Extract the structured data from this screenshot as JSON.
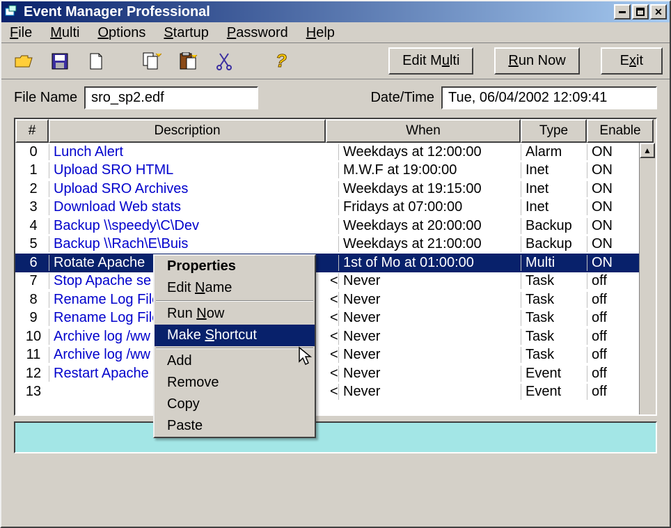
{
  "window": {
    "title": "Event Manager Professional"
  },
  "menubar": [
    "File",
    "Multi",
    "Options",
    "Startup",
    "Password",
    "Help"
  ],
  "toolbar_buttons": {
    "edit_multi": "Edit Multi",
    "run_now": "Run Now",
    "exit": "Exit"
  },
  "form": {
    "file_name_label": "File Name",
    "file_name_value": "sro_sp2.edf",
    "datetime_label": "Date/Time",
    "datetime_value": "Tue, 06/04/2002  12:09:41"
  },
  "columns": {
    "num": "#",
    "desc": "Description",
    "when": "When",
    "type": "Type",
    "enable": "Enable"
  },
  "rows": [
    {
      "n": "0",
      "desc": "Lunch Alert",
      "arrow": "",
      "when": "Weekdays at 12:00:00",
      "type": "Alarm",
      "enable": "ON",
      "sel": false
    },
    {
      "n": "1",
      "desc": "Upload SRO HTML",
      "arrow": "",
      "when": "M.W.F at 19:00:00",
      "type": "Inet",
      "enable": "ON",
      "sel": false
    },
    {
      "n": "2",
      "desc": "Upload SRO Archives",
      "arrow": "",
      "when": "Weekdays at 19:15:00",
      "type": "Inet",
      "enable": "ON",
      "sel": false
    },
    {
      "n": "3",
      "desc": "Download Web stats",
      "arrow": "",
      "when": "Fridays at 07:00:00",
      "type": "Inet",
      "enable": "ON",
      "sel": false
    },
    {
      "n": "4",
      "desc": "Backup \\\\speedy\\C\\Dev",
      "arrow": "",
      "when": "Weekdays at 20:00:00",
      "type": "Backup",
      "enable": "ON",
      "sel": false
    },
    {
      "n": "5",
      "desc": "Backup \\\\Rach\\E\\Buis",
      "arrow": "",
      "when": "Weekdays at 21:00:00",
      "type": "Backup",
      "enable": "ON",
      "sel": false
    },
    {
      "n": "6",
      "desc": "Rotate Apache",
      "arrow": "",
      "when": "1st of Mo at 01:00:00",
      "type": "Multi",
      "enable": "ON",
      "sel": true
    },
    {
      "n": "7",
      "desc": "Stop Apache se",
      "arrow": "<-",
      "when": "Never",
      "type": "Task",
      "enable": "off",
      "sel": false
    },
    {
      "n": "8",
      "desc": "Rename Log File",
      "arrow": "<-",
      "when": "Never",
      "type": "Task",
      "enable": "off",
      "sel": false
    },
    {
      "n": "9",
      "desc": "Rename Log File",
      "arrow": "<-",
      "when": "Never",
      "type": "Task",
      "enable": "off",
      "sel": false
    },
    {
      "n": "10",
      "desc": "Archive log /ww",
      "arrow": "<-",
      "when": "Never",
      "type": "Task",
      "enable": "off",
      "sel": false
    },
    {
      "n": "11",
      "desc": "Archive log /ww",
      "arrow": "<-",
      "when": "Never",
      "type": "Task",
      "enable": "off",
      "sel": false
    },
    {
      "n": "12",
      "desc": "Restart Apache",
      "arrow": "<-",
      "when": "Never",
      "type": "Event",
      "enable": "off",
      "sel": false
    },
    {
      "n": "13",
      "desc": "",
      "arrow": "<-",
      "when": "Never",
      "type": "Event",
      "enable": "off",
      "sel": false
    }
  ],
  "context_menu": [
    {
      "label": "Properties",
      "bold": true,
      "sel": false
    },
    {
      "label": "Edit Name",
      "bold": false,
      "sel": false
    },
    {
      "sep": true
    },
    {
      "label": "Run Now",
      "bold": false,
      "sel": false
    },
    {
      "label": "Make Shortcut",
      "bold": false,
      "sel": true
    },
    {
      "sep": true
    },
    {
      "label": "Add",
      "bold": false,
      "sel": false
    },
    {
      "label": "Remove",
      "bold": false,
      "sel": false
    },
    {
      "label": "Copy",
      "bold": false,
      "sel": false
    },
    {
      "label": "Paste",
      "bold": false,
      "sel": false
    }
  ]
}
